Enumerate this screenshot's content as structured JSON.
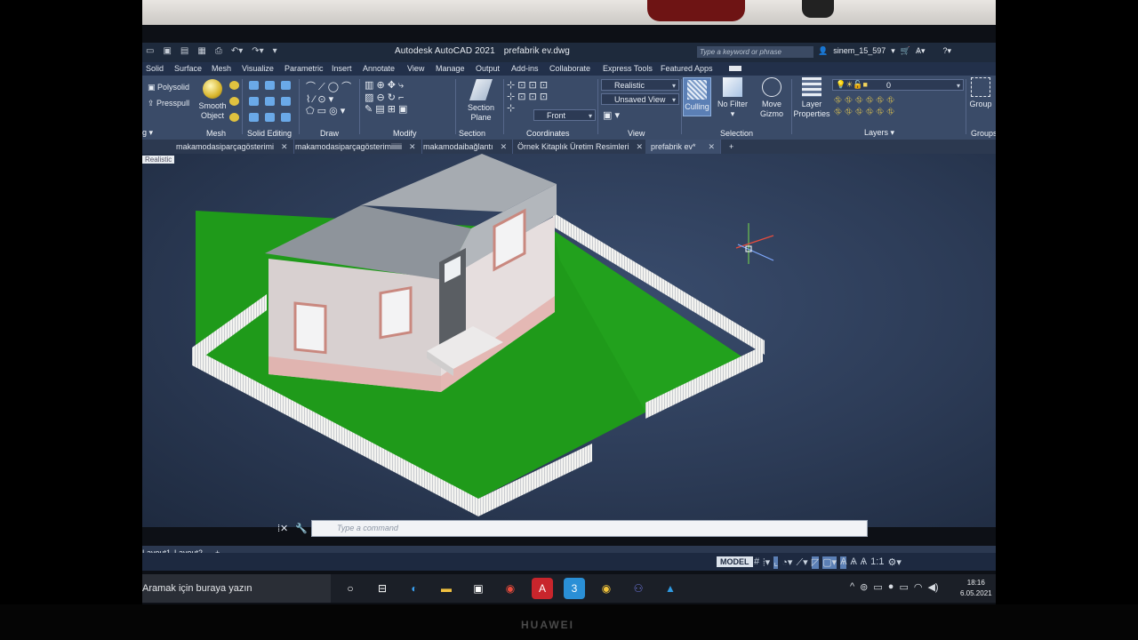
{
  "app": {
    "title": "Autodesk AutoCAD 2021",
    "document": "prefabrik ev.dwg",
    "search_placeholder": "Type a keyword or phrase",
    "user": "sinem_15_597"
  },
  "menu": [
    "Solid",
    "Surface",
    "Mesh",
    "Visualize",
    "Parametric",
    "Insert",
    "Annotate",
    "View",
    "Manage",
    "Output",
    "Add-ins",
    "Collaborate",
    "Express Tools",
    "Featured Apps"
  ],
  "ribbon": {
    "polysolid": "Polysolid",
    "presspull": "Presspull",
    "smooth_object": "Smooth Object",
    "section_plane": "Section Plane",
    "visual_style": "Realistic",
    "view_name": "Unsaved View",
    "front": "Front",
    "culling": "Culling",
    "no_filter": "No Filter",
    "move_gizmo": "Move Gizmo",
    "layer_properties": "Layer Properties",
    "layer_value": "0",
    "group": "Group",
    "groups": [
      "Mesh",
      "Solid Editing",
      "Draw",
      "Modify",
      "Section",
      "Coordinates",
      "View",
      "Selection",
      "Layers",
      "Groups"
    ]
  },
  "tabs": [
    {
      "label": "makamodasiparçagösterimi",
      "active": false
    },
    {
      "label": "makamodasiparçagösterimiiiiii",
      "active": false
    },
    {
      "label": "makamodaibağlantı",
      "active": false
    },
    {
      "label": "Örnek Kitaplık Üretim Resimleri",
      "active": false
    },
    {
      "label": "prefabrik ev*",
      "active": true
    }
  ],
  "viewport": {
    "label": "Realistic"
  },
  "command": {
    "placeholder": "Type a command"
  },
  "layouts": [
    "Layout1",
    "Layout2"
  ],
  "status": {
    "model": "MODEL",
    "scale": "1:1"
  },
  "taskbar": {
    "search": "Aramak için buraya yazın",
    "time": "18:16",
    "date": "6.05.2021"
  },
  "monitor": {
    "brand": "HUAWEI"
  },
  "colors": {
    "ribbon": "#3a4b68",
    "grass": "#1f9a1a",
    "fence": "#f1f1ee",
    "roof": "#9aa0a6",
    "wall": "#d9d1d1",
    "accent": "#e84c3d"
  }
}
